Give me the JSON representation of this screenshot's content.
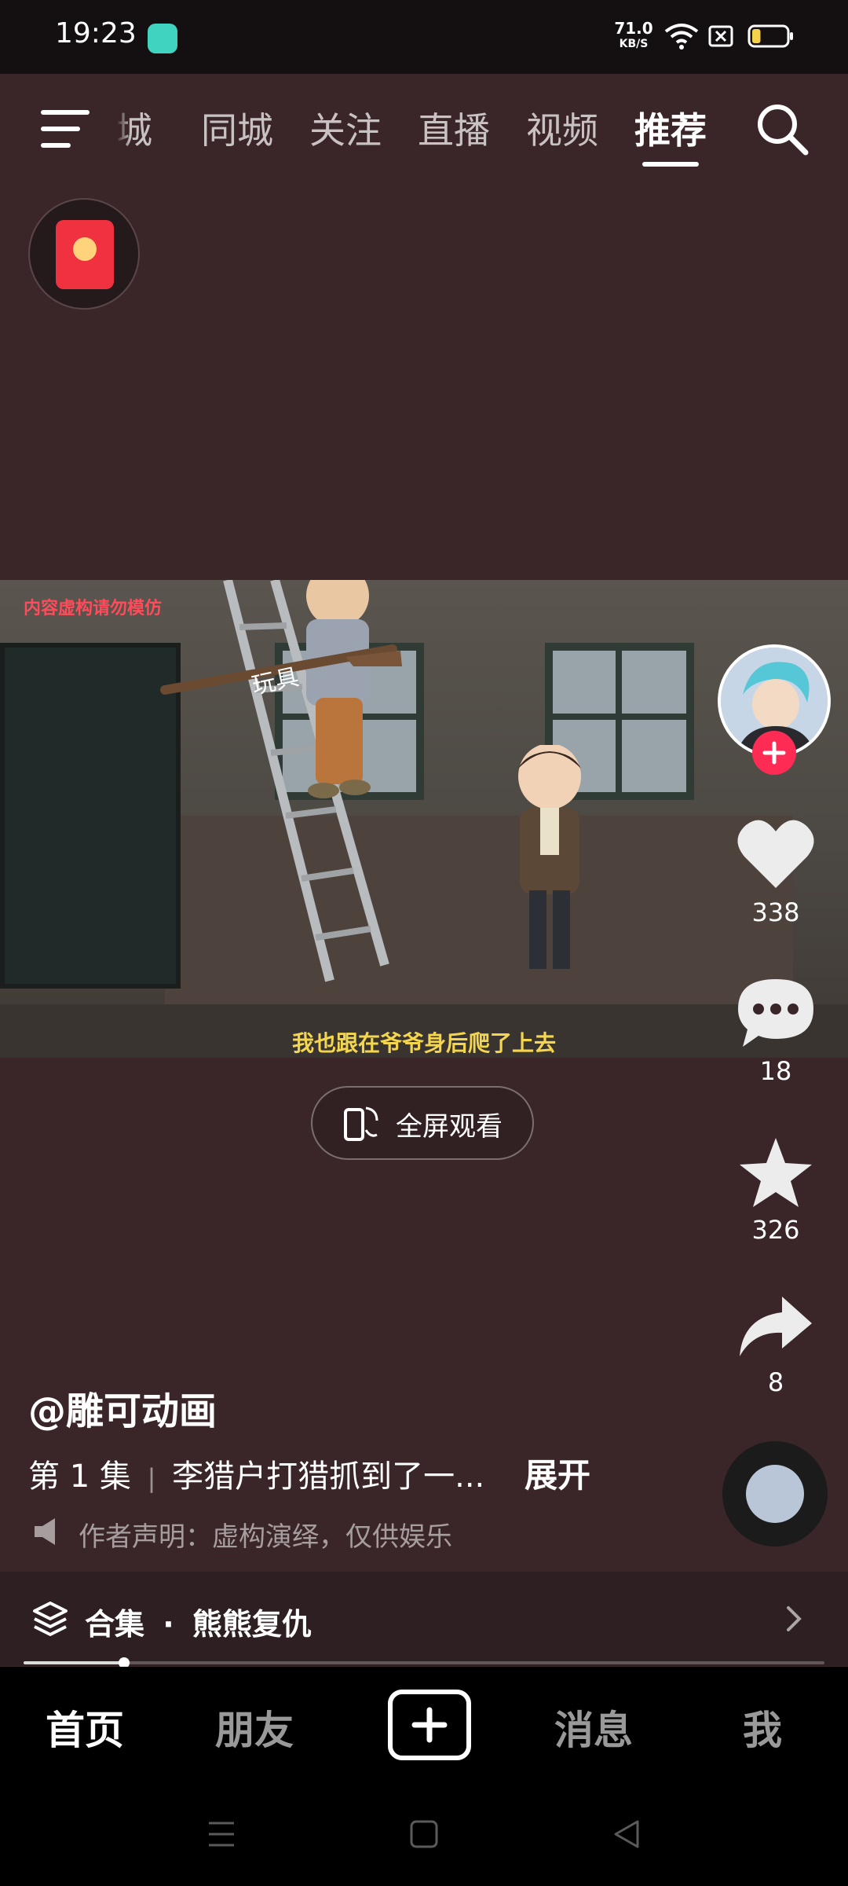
{
  "status_bar": {
    "time": "19:23",
    "net_speed_value": "71.0",
    "net_speed_unit": "KB/S",
    "battery_level": 0.25
  },
  "top_nav": {
    "tabs": [
      {
        "label": "城"
      },
      {
        "label": "同城"
      },
      {
        "label": "关注"
      },
      {
        "label": "直播"
      },
      {
        "label": "视频"
      },
      {
        "label": "推荐",
        "active": true
      }
    ]
  },
  "video": {
    "warning": "内容虚构请勿模仿",
    "overlay_label": "玩具",
    "subtitle": "我也跟在爷爷身后爬了上去",
    "fullscreen_label": "全屏观看"
  },
  "actions": {
    "likes": "338",
    "comments": "18",
    "favorites": "326",
    "shares": "8"
  },
  "caption": {
    "author": "@雕可动画",
    "episode": "第 1 集",
    "title": "李猎户打猎抓到了一...",
    "expand": "展开",
    "declaration": "作者声明：虚构演绎，仅供娱乐"
  },
  "collection": {
    "label": "合集",
    "separator": "·",
    "name": "熊熊复仇"
  },
  "progress": {
    "fraction": 0.125
  },
  "bottom_nav": {
    "home": "首页",
    "friends": "朋友",
    "messages": "消息",
    "me": "我"
  },
  "colors": {
    "background": "#3a2628",
    "accent": "#fe2c55",
    "subtitle": "#f4d64e",
    "warning": "#ff4b5a"
  }
}
